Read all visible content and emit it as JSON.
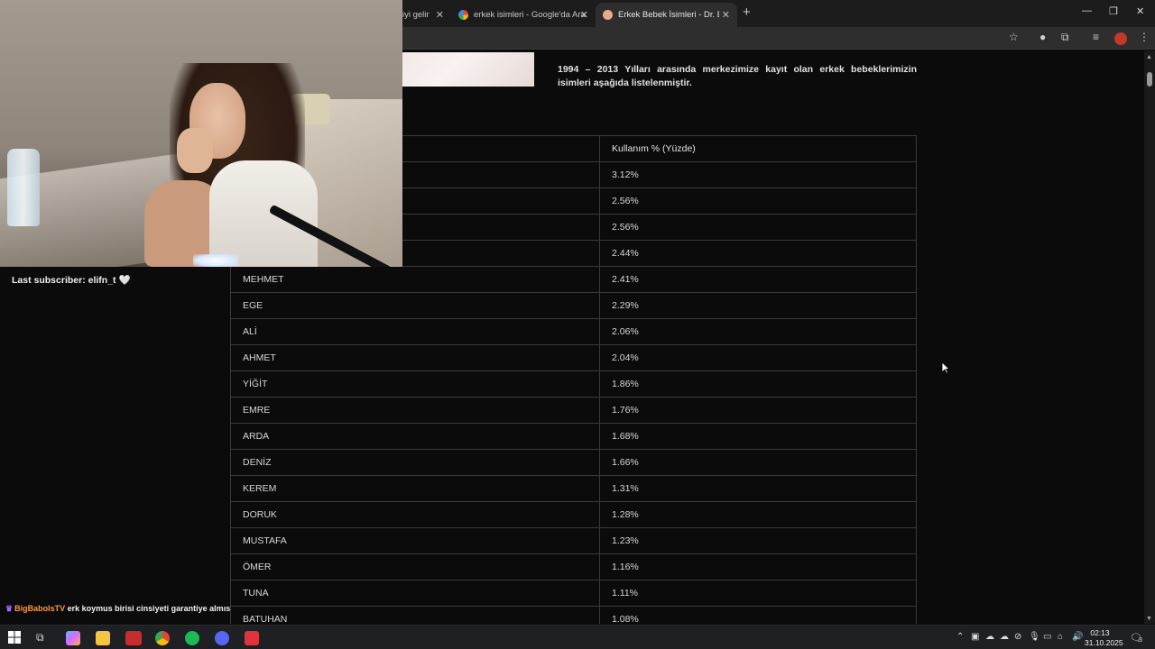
{
  "browser": {
    "tabs": [
      {
        "label": "iyi gelir",
        "active": false
      },
      {
        "label": "erkek isimleri - Google'da Ara",
        "active": false
      },
      {
        "label": "Erkek Bebek İsimleri - Dr. Ertuğ",
        "active": true
      }
    ],
    "close_glyph": "✕",
    "new_tab_glyph": "+",
    "window": {
      "minimize": "—",
      "restore": "❐",
      "close": "✕"
    }
  },
  "page": {
    "intro_text": "1994 – 2013 Yılları arasında merkezimize kayıt olan erkek bebeklerimizin isimleri aşağıda listelenmiştir.",
    "table": {
      "header": [
        "",
        "Kullanım % (Yüzde)"
      ],
      "rows": [
        {
          "name": "",
          "pct": "3.12%"
        },
        {
          "name": "",
          "pct": "2.56%"
        },
        {
          "name": "",
          "pct": "2.56%"
        },
        {
          "name": "",
          "pct": "2.44%"
        },
        {
          "name": "MEHMET",
          "pct": "2.41%"
        },
        {
          "name": "EGE",
          "pct": "2.29%"
        },
        {
          "name": "ALİ",
          "pct": "2.06%"
        },
        {
          "name": "AHMET",
          "pct": "2.04%"
        },
        {
          "name": "YİĞİT",
          "pct": "1.86%"
        },
        {
          "name": "EMRE",
          "pct": "1.76%"
        },
        {
          "name": "ARDA",
          "pct": "1.68%"
        },
        {
          "name": "DENİZ",
          "pct": "1.66%"
        },
        {
          "name": "KEREM",
          "pct": "1.31%"
        },
        {
          "name": "DORUK",
          "pct": "1.28%"
        },
        {
          "name": "MUSTAFA",
          "pct": "1.23%"
        },
        {
          "name": "ÖMER",
          "pct": "1.16%"
        },
        {
          "name": "TUNA",
          "pct": "1.11%"
        },
        {
          "name": "BATUHAN",
          "pct": "1.08%"
        }
      ]
    }
  },
  "stream": {
    "last_subscriber": "Last subscriber: elifn_t 🤍",
    "chat": {
      "badge": "♛",
      "user": "BigBabolsTV",
      "message": "erk koymus birisi cinsiyeti garantiye almıs"
    }
  },
  "taskbar": {
    "time": "02:13",
    "date": "31.10.2025",
    "notification_count": "3",
    "icon_colors": {
      "copilot": "#5fb0ff",
      "explorer": "#f4c542",
      "chrome": "#34a853",
      "spotify": "#1db954",
      "discord": "#5865f2",
      "vivaldi": "#e0343c",
      "app": "#c72d2d"
    }
  }
}
